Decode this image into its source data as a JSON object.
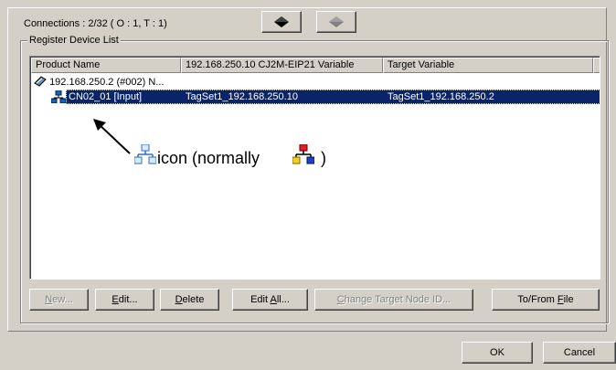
{
  "connections": {
    "label": "Connections :",
    "value": "2/32 ( O : 1, T : 1)"
  },
  "group": {
    "title": "Register Device List"
  },
  "columns": [
    "Product Name",
    "192.168.250.10 CJ2M-EIP21 Variable",
    "Target Variable"
  ],
  "tree": {
    "parent": "192.168.250.2 (#002) N...",
    "child": {
      "product": "CN02_01 [Input]",
      "variable": "TagSet1_192.168.250.10",
      "target": "TagSet1_192.168.250.2"
    }
  },
  "annotation": {
    "text_before": "icon (normally ",
    "text_after": ")"
  },
  "buttons": {
    "new": {
      "u": "N",
      "rest": "ew..."
    },
    "edit": {
      "u": "E",
      "rest": "dit..."
    },
    "delete": {
      "u": "D",
      "rest": "elete"
    },
    "edit_all_pre": "Edit ",
    "edit_all_u": "A",
    "edit_all_rest": "ll...",
    "change_pre": "",
    "change_u": "C",
    "change_rest": "hange Target Node ID...",
    "tofrom_pre": "To/From ",
    "tofrom_u": "F",
    "tofrom_rest": "ile",
    "ok": "OK",
    "cancel": "Cancel"
  },
  "colors": {
    "selection": "#0a246a",
    "face": "#d4d0c8"
  }
}
